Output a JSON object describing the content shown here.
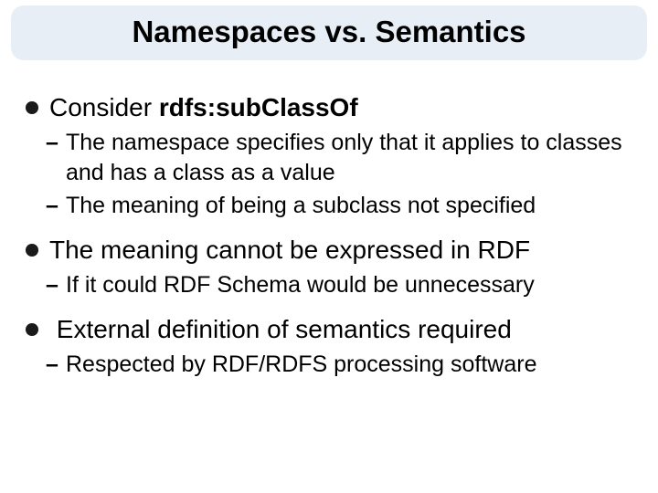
{
  "title": "Namespaces vs. Semantics",
  "bullets": [
    {
      "lead": "Consider ",
      "bold_after": "rdfs:subClassOf",
      "subs": [
        "The namespace specifies only that it applies to classes and has a class as a value",
        "The meaning of being a subclass not specified"
      ]
    },
    {
      "lead": "The meaning cannot be expressed in RDF",
      "bold_after": "",
      "subs": [
        "If it could RDF Schema would be unnecessary"
      ]
    },
    {
      "lead": " External definition of semantics required",
      "bold_after": "",
      "subs": [
        "Respected by RDF/RDFS processing software"
      ]
    }
  ]
}
